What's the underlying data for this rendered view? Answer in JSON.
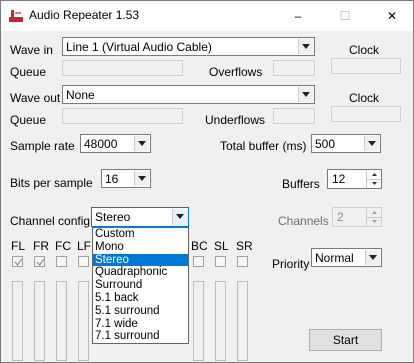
{
  "window": {
    "title": "Audio Repeater 1.53",
    "controls": [
      "–",
      "☐",
      "✕"
    ]
  },
  "wave_in": {
    "label": "Wave in",
    "device": "Line 1 (Virtual Audio Cable)",
    "queue_label": "Queue",
    "overflows_label": "Overflows",
    "clock_label": "Clock"
  },
  "wave_out": {
    "label": "Wave out",
    "device": "None",
    "queue_label": "Queue",
    "underflows_label": "Underflows",
    "clock_label": "Clock"
  },
  "sample_rate": {
    "label": "Sample rate",
    "value": "48000"
  },
  "total_buffer": {
    "label": "Total buffer (ms)",
    "value": "500"
  },
  "bits_per_sample": {
    "label": "Bits per sample",
    "value": "16"
  },
  "buffers": {
    "label": "Buffers",
    "value": "12"
  },
  "channel_config": {
    "label": "Channel config",
    "value": "Stereo",
    "options": [
      "Custom",
      "Mono",
      "Stereo",
      "Quadraphonic",
      "Surround",
      "5.1 back",
      "5.1 surround",
      "7.1 wide",
      "7.1 surround"
    ],
    "selected_index": 2
  },
  "channels": {
    "label": "Channels",
    "value": "2"
  },
  "channel_labels": [
    "FL",
    "FR",
    "FC",
    "LF",
    "BC",
    "SL",
    "SR"
  ],
  "channel_checked": [
    true,
    true,
    false,
    false,
    false,
    false,
    false
  ],
  "priority": {
    "label": "Priority",
    "value": "Normal"
  },
  "start_button": {
    "label": "Start"
  },
  "colors": {
    "selection": "#0078d7",
    "window_bg": "#f0f0f0"
  }
}
